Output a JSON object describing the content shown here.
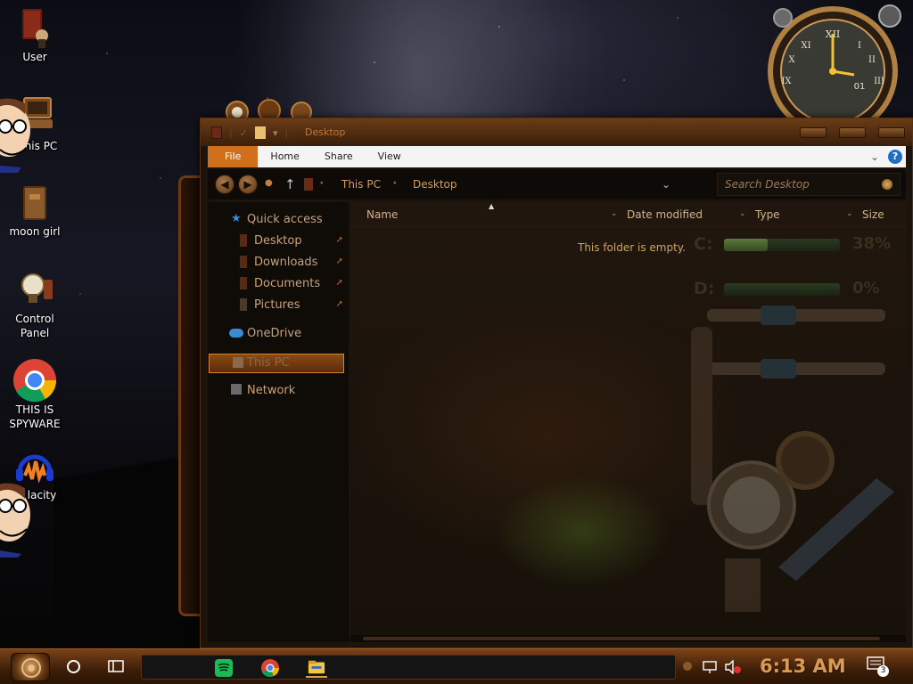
{
  "desktop": {
    "icons": [
      {
        "label": "User",
        "icon": "user-folder-icon"
      },
      {
        "label": "his PC",
        "icon": "this-pc-icon"
      },
      {
        "label": "moon girl",
        "icon": "folder-icon"
      },
      {
        "label": "Control Panel",
        "icon": "light-bulb-icon"
      },
      {
        "label": "THIS IS SPYWARE",
        "icon": "chrome-icon"
      },
      {
        "label": "lacity",
        "icon": "audacity-icon"
      }
    ]
  },
  "clock_widget": {
    "day": "01",
    "numerals": [
      "XII",
      "I",
      "II",
      "III",
      "IX",
      "X",
      "XI"
    ]
  },
  "window": {
    "title": "Desktop",
    "ribbon_tabs": [
      {
        "label": "File",
        "active": true
      },
      {
        "label": "Home"
      },
      {
        "label": "Share"
      },
      {
        "label": "View"
      }
    ],
    "address": {
      "crumbs": [
        "This PC",
        "Desktop"
      ]
    },
    "search": {
      "placeholder": "Search Desktop"
    },
    "nav_pane": {
      "items": [
        {
          "label": "Quick access",
          "icon": "star-icon",
          "level": 0,
          "pinned": false
        },
        {
          "label": "Desktop",
          "icon": "desktop-folder-icon",
          "level": 1,
          "pinned": true
        },
        {
          "label": "Downloads",
          "icon": "downloads-folder-icon",
          "level": 1,
          "pinned": true
        },
        {
          "label": "Documents",
          "icon": "documents-folder-icon",
          "level": 1,
          "pinned": true
        },
        {
          "label": "Pictures",
          "icon": "pictures-folder-icon",
          "level": 1,
          "pinned": true
        },
        {
          "label": "OneDrive",
          "icon": "cloud-icon",
          "level": 0,
          "pinned": false
        },
        {
          "label": "This PC",
          "icon": "computer-icon",
          "level": 0,
          "selected": true
        },
        {
          "label": "Network",
          "icon": "network-icon",
          "level": 0,
          "pinned": false
        }
      ]
    },
    "columns": [
      "Name",
      "Date modified",
      "Type",
      "Size"
    ],
    "empty_message": "This folder is empty.",
    "drives": [
      {
        "letter": "C:",
        "percent": "38%",
        "fill": 38
      },
      {
        "letter": "D:",
        "percent": "0%",
        "fill": 0
      }
    ]
  },
  "taskbar": {
    "apps": [
      {
        "name": "spotify-icon",
        "color": "#1db954"
      },
      {
        "name": "chrome-icon",
        "color": "#db4437"
      },
      {
        "name": "file-explorer-icon",
        "color": "#f5c542",
        "active": true
      }
    ],
    "time": "6:13 AM",
    "notification_count": "3"
  },
  "colors": {
    "accent": "#d0701c",
    "window_bg": "#1c140c",
    "titlebar": "#5a2f10",
    "text_gold": "#d29d5e"
  }
}
